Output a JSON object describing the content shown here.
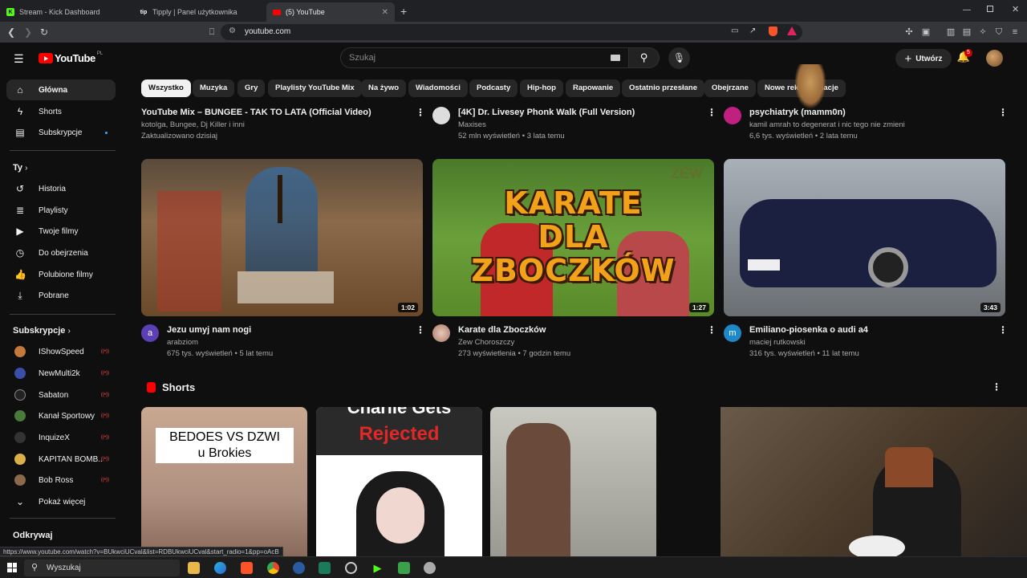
{
  "browser": {
    "tabs": [
      {
        "title": "Stream - Kick Dashboard",
        "favicon": "K",
        "color": "#53fc18"
      },
      {
        "title": "Tipply | Panel użytkownika",
        "favicon": "tip",
        "color": "#ffffff"
      },
      {
        "title": "(5) YouTube",
        "favicon": "yt",
        "color": "#ff0000",
        "active": true
      }
    ],
    "url": "youtube.com",
    "status_url": "https://www.youtube.com/watch?v=BUkwciUCval&list=RDBUkwciUCval&start_radio=1&pp=oAcB"
  },
  "masthead": {
    "logo_text": "YouTube",
    "country_code": "PL",
    "search_placeholder": "Szukaj",
    "create_label": "Utwórz",
    "notifications_count": "5"
  },
  "sidebar": {
    "main": [
      {
        "label": "Główna",
        "icon": "home-icon",
        "selected": true
      },
      {
        "label": "Shorts",
        "icon": "shorts-icon"
      },
      {
        "label": "Subskrypcje",
        "icon": "subscriptions-icon",
        "dot": true
      }
    ],
    "you_header": "Ty",
    "you": [
      {
        "label": "Historia",
        "icon": "history-icon"
      },
      {
        "label": "Playlisty",
        "icon": "playlists-icon"
      },
      {
        "label": "Twoje filmy",
        "icon": "your-videos-icon"
      },
      {
        "label": "Do obejrzenia",
        "icon": "watch-later-icon"
      },
      {
        "label": "Polubione filmy",
        "icon": "liked-icon"
      },
      {
        "label": "Pobrane",
        "icon": "download-icon"
      }
    ],
    "subs_header": "Subskrypcje",
    "subs": [
      {
        "label": "IShowSpeed",
        "color": "#c47a3a"
      },
      {
        "label": "NewMulti2k",
        "color": "#3a4ea8"
      },
      {
        "label": "Sabaton",
        "color": "#222222"
      },
      {
        "label": "Kanał Sportowy",
        "color": "#4a7a3a"
      },
      {
        "label": "InquizeX",
        "color": "#333333"
      },
      {
        "label": "KAPITAN BOMB...",
        "color": "#d9b04a"
      },
      {
        "label": "Bob Ross",
        "color": "#8a6a4a"
      }
    ],
    "show_more": "Pokaż więcej",
    "explore_header": "Odkrywaj"
  },
  "chips": [
    "Wszystko",
    "Muzyka",
    "Gry",
    "Playlisty YouTube Mix",
    "Na żywo",
    "Wiadomości",
    "Podcasty",
    "Hip-hop",
    "Rapowanie",
    "Ostatnio przesłane",
    "Obejrzane",
    "Nowe rekomendacje"
  ],
  "top_row": [
    {
      "title": "YouTube Mix – BUNGEE - TAK TO LATA (Official Video)",
      "channel": "kotolga, Bungee, Dj Killer i inni",
      "stats": "Zaktualizowano dzisiaj"
    },
    {
      "title": "[4K] Dr. Livesey Phonk Walk (Full Version)",
      "channel": "Maxises",
      "stats": "52 mln wyświetleń • 3 lata temu"
    },
    {
      "title": "psychiatryk (mamm0n)",
      "channel": "kamil amrah to degenerat i nic tego nie zmieni",
      "stats": "6,6 tys. wyświetleń • 2 lata temu"
    }
  ],
  "videos": [
    {
      "title": "Jezu umyj nam nogi",
      "channel": "arabziom",
      "stats": "675 tys. wyświetleń • 5 lat temu",
      "duration": "1:02",
      "avatar": "a",
      "avatar_color": "#5b3fb5"
    },
    {
      "title": "Karate dla Zboczków",
      "channel": "Zew Choroszczy",
      "stats": "273 wyświetlenia • 7 godzin temu",
      "duration": "1:27",
      "thumb_text": [
        "KARATE",
        "DLA",
        "ZBOCZKÓW"
      ],
      "watermark": "ZEW"
    },
    {
      "title": "Emiliano-piosenka o audi a4",
      "channel": "maciej rutkowski",
      "stats": "316 tys. wyświetleń • 11 lat temu",
      "duration": "3:43",
      "avatar": "m",
      "avatar_color": "#1e88c7"
    }
  ],
  "shorts": {
    "header": "Shorts",
    "items": [
      {
        "text_line1": "BEDOES VS DZWI",
        "text_line2": "u Brokies"
      },
      {
        "text_line1": "Charlie Gets",
        "text_line2": "Rejected"
      },
      {},
      {}
    ]
  },
  "taskbar": {
    "search_label": "Wyszukaj"
  }
}
